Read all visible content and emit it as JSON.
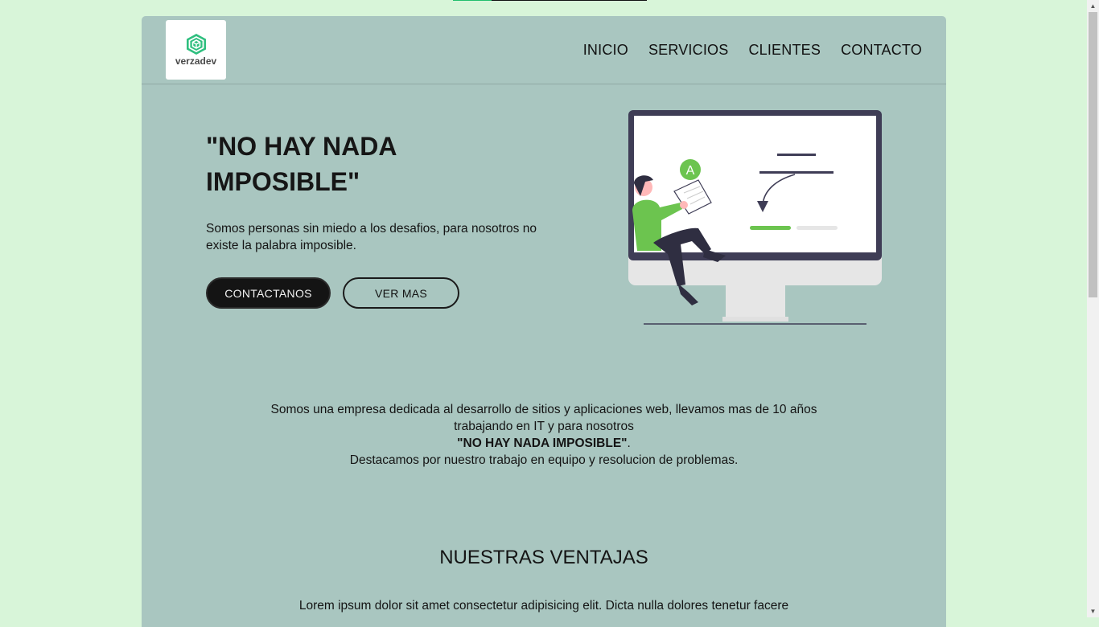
{
  "progress": {
    "value_percent": 20,
    "fill_color": "#22bf6e"
  },
  "brand": {
    "name": "verzadev",
    "logo_icon": "hexagon-cube-icon",
    "accent": "#22a86a"
  },
  "nav": {
    "items": [
      {
        "label": "INICIO"
      },
      {
        "label": "SERVICIOS"
      },
      {
        "label": "CLIENTES"
      },
      {
        "label": "CONTACTO"
      }
    ]
  },
  "hero": {
    "title_line1": "\"NO HAY NADA",
    "title_line2": "IMPOSIBLE\"",
    "subtitle": "Somos personas sin miedo a los desafios, para nosotros no existe la palabra imposible.",
    "primary_button": "CONTACTANOS",
    "secondary_button": "VER MAS",
    "illustration_badge": "A"
  },
  "about": {
    "line1": "Somos una empresa dedicada al desarrollo de sitios y aplicaciones web, llevamos mas de 10 años trabajando en IT y para nosotros",
    "highlight": "\"NO HAY NADA IMPOSIBLE\"",
    "highlight_suffix": ".",
    "line3": "Destacamos por nuestro trabajo en equipo y resolucion de problemas."
  },
  "advantages": {
    "title": "NUESTRAS VENTAJAS",
    "text": "Lorem ipsum dolor sit amet consectetur adipisicing elit. Dicta nulla dolores tenetur facere"
  },
  "colors": {
    "page_background": "#d8f5d9",
    "card_background": "#a9c6c0",
    "primary_button": "#141414",
    "illustration_green": "#6cc44f",
    "monitor_frame": "#3f3d56"
  }
}
